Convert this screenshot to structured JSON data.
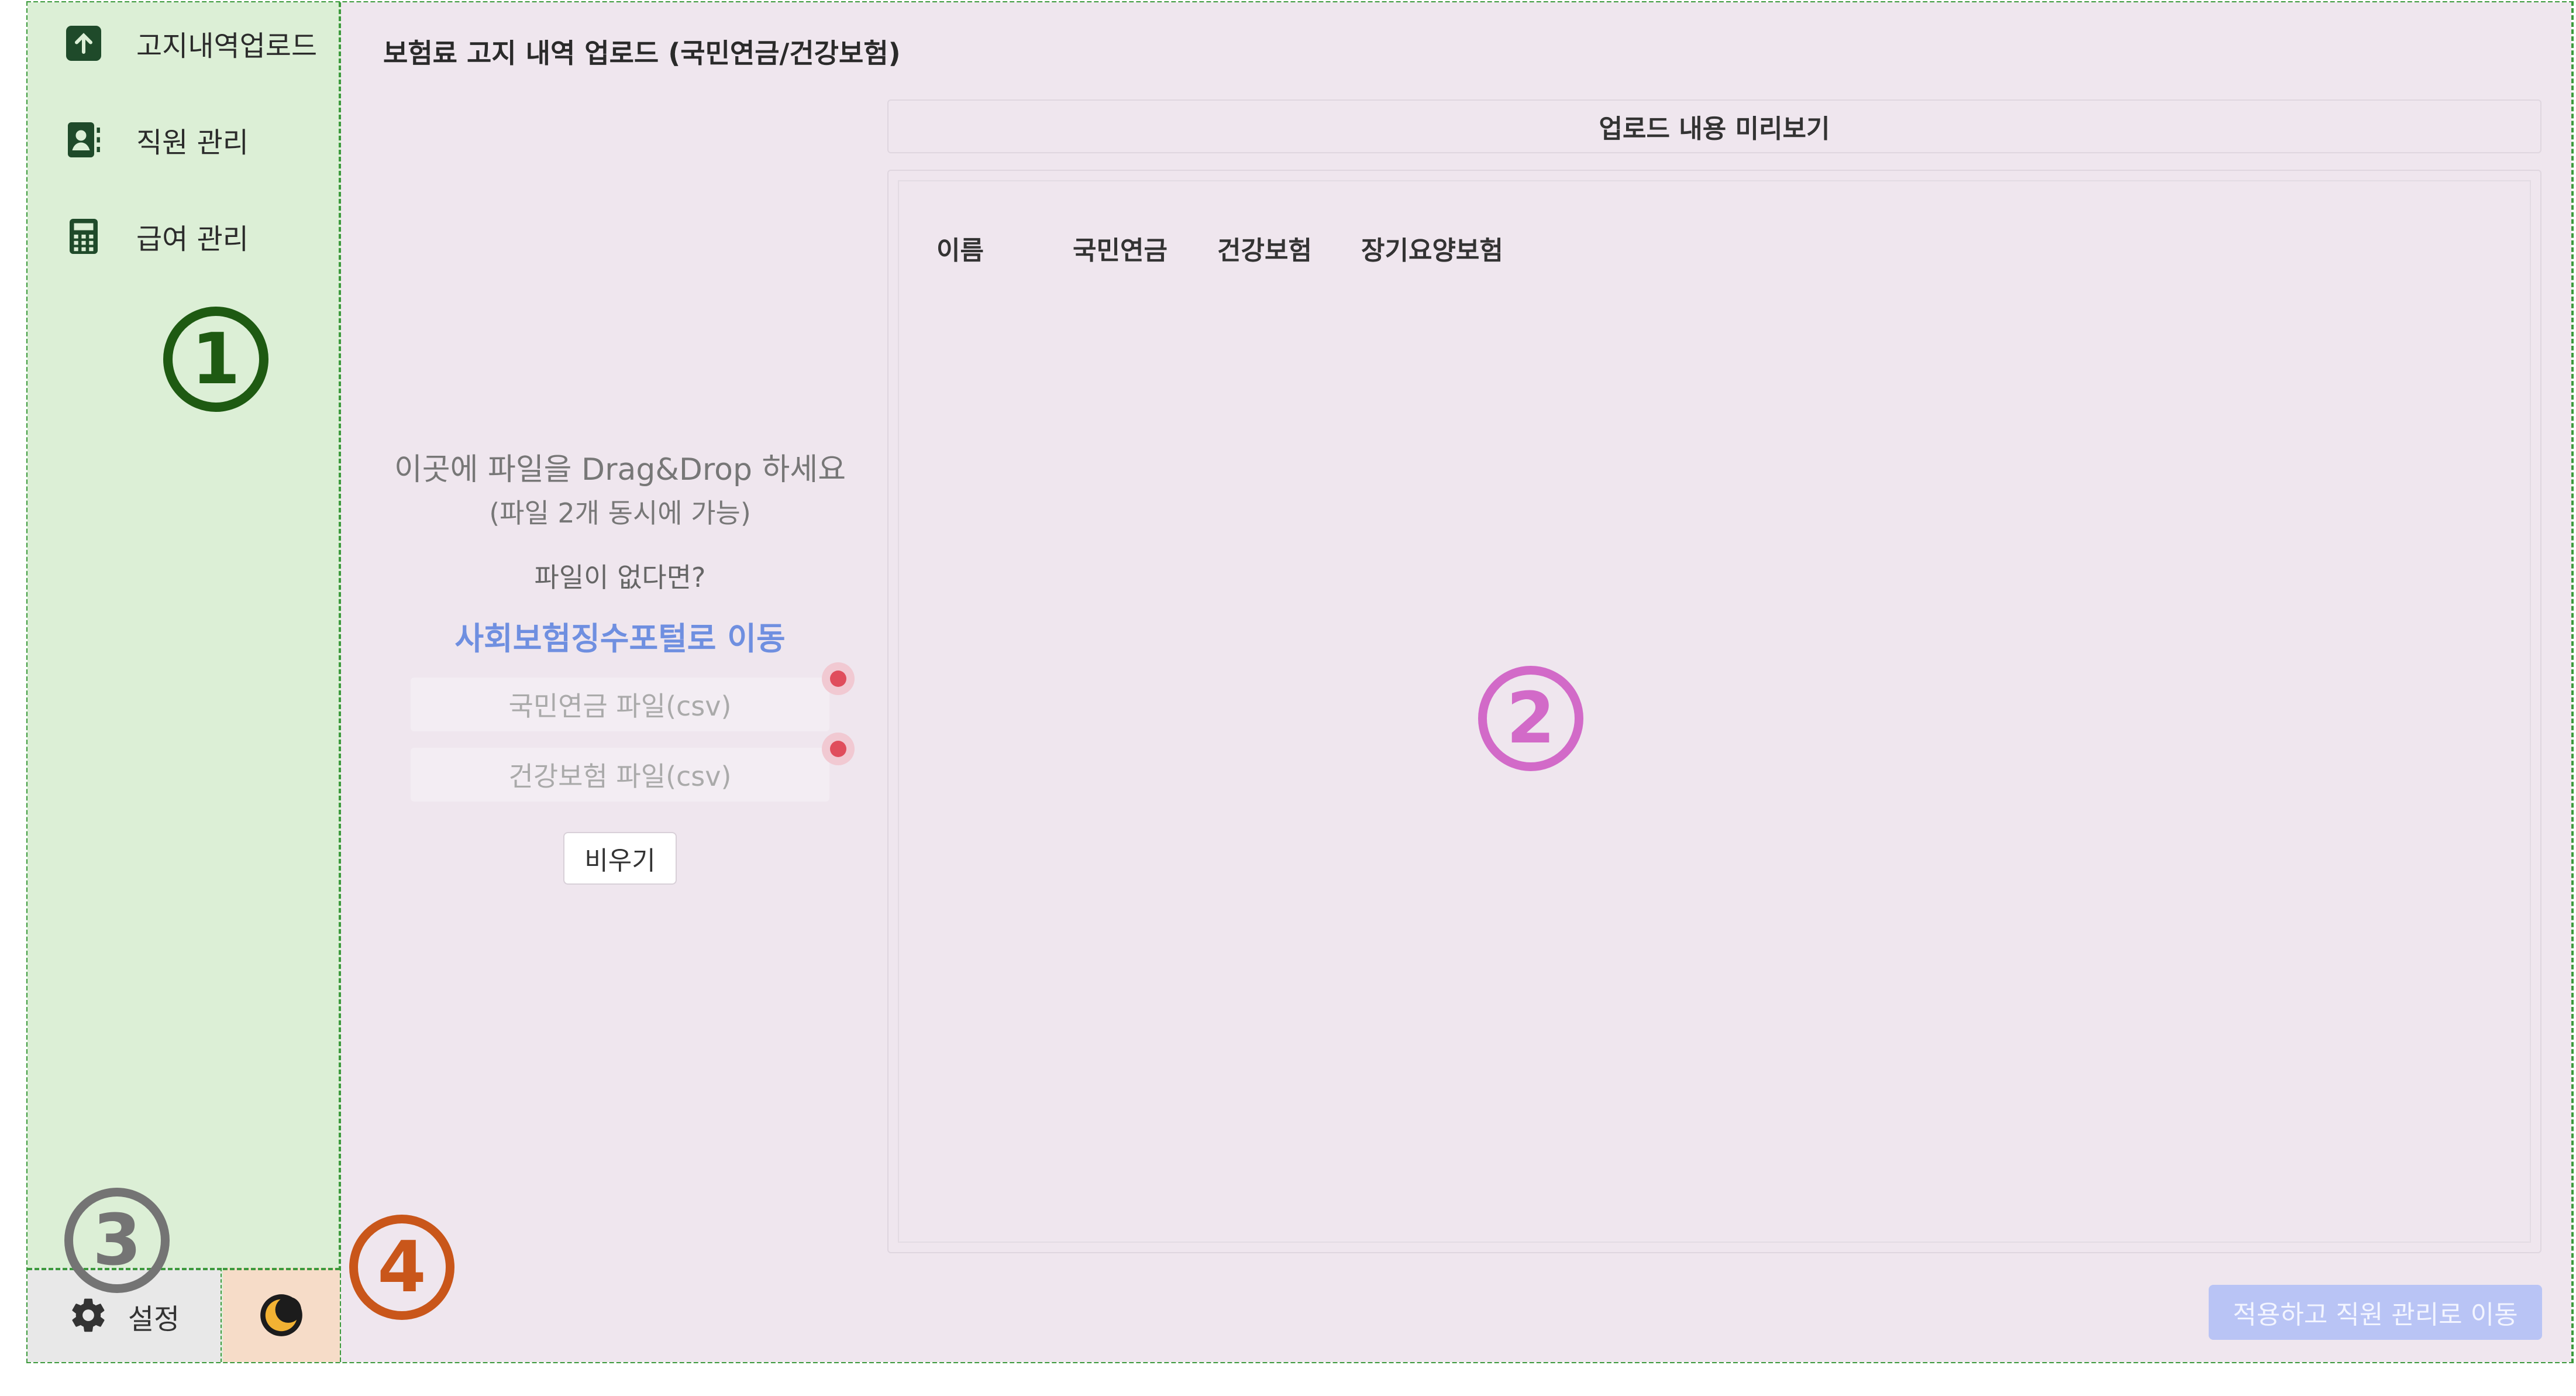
{
  "sidebar": {
    "items": [
      {
        "label": "고지내역업로드",
        "icon": "upload-icon"
      },
      {
        "label": "직원 관리",
        "icon": "contacts-icon"
      },
      {
        "label": "급여 관리",
        "icon": "calculator-icon"
      }
    ]
  },
  "annotations": {
    "one": "①",
    "two": "②",
    "three": "③",
    "four": "④"
  },
  "main": {
    "title": "보험료 고지 내역 업로드 (국민연금/건강보험)",
    "drop_zone": {
      "line1": "이곳에 파일을 Drag&Drop 하세요",
      "line2": "(파일 2개 동시에 가능)",
      "no_file": "파일이 없다면?",
      "portal_link": "사회보험징수포털로 이동"
    },
    "files": [
      {
        "placeholder": "국민연금 파일(csv)"
      },
      {
        "placeholder": "건강보험 파일(csv)"
      }
    ],
    "clear_button": "비우기",
    "preview": {
      "title": "업로드 내용 미리보기",
      "columns": [
        "이름",
        "국민연금",
        "건강보험",
        "장기요양보험"
      ]
    },
    "apply_button": "적용하고 직원 관리로 이동"
  },
  "footer": {
    "settings_label": "설정",
    "theme_icon": "moon-icon"
  },
  "colors": {
    "sidebar_bg": "#dcefd6",
    "main_bg": "#efe6ee",
    "link": "#6f8fe0",
    "apply_button": "#b9c4f5",
    "annotation_green": "#1e5a12",
    "annotation_pink": "#d26ac8",
    "annotation_gray": "#747474",
    "annotation_orange": "#c9561a"
  }
}
